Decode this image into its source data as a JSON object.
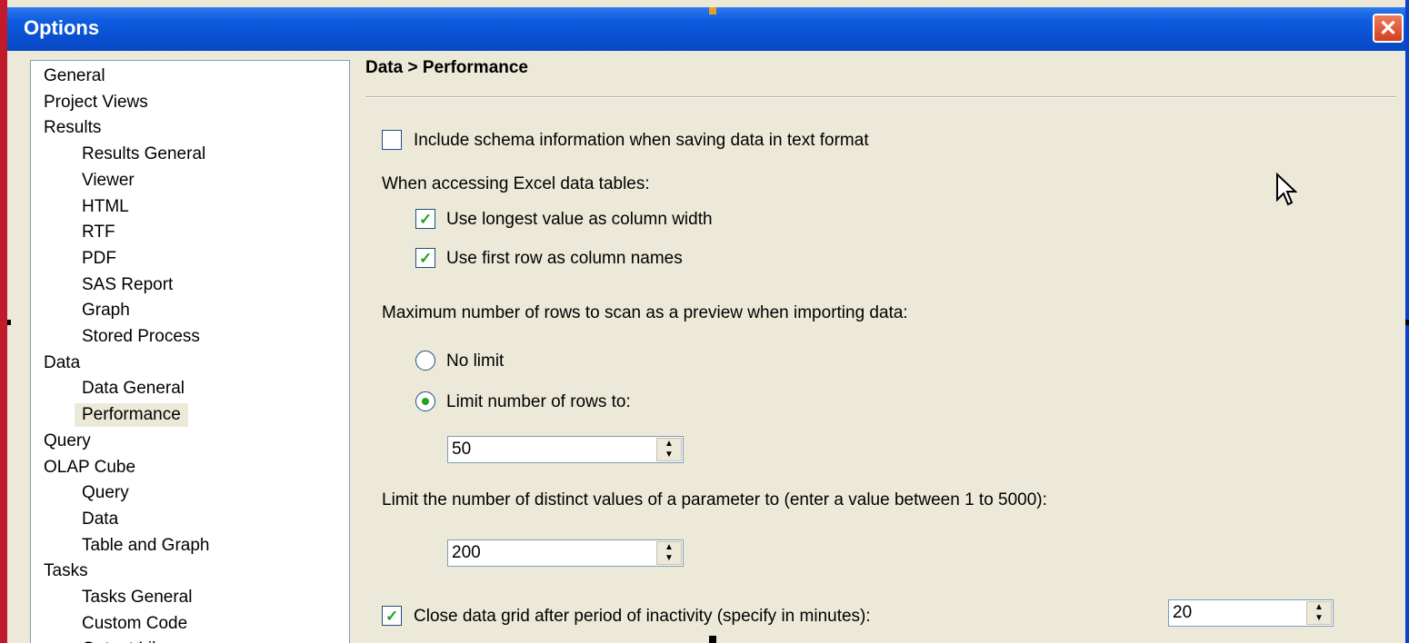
{
  "window": {
    "title": "Options",
    "close_glyph": "✕"
  },
  "tree": {
    "items": [
      {
        "label": "General",
        "indent": 0
      },
      {
        "label": "Project Views",
        "indent": 0
      },
      {
        "label": "Results",
        "indent": 0
      },
      {
        "label": "Results General",
        "indent": 1
      },
      {
        "label": "Viewer",
        "indent": 1
      },
      {
        "label": "HTML",
        "indent": 1
      },
      {
        "label": "RTF",
        "indent": 1
      },
      {
        "label": "PDF",
        "indent": 1
      },
      {
        "label": "SAS Report",
        "indent": 1
      },
      {
        "label": "Graph",
        "indent": 1
      },
      {
        "label": "Stored Process",
        "indent": 1
      },
      {
        "label": "Data",
        "indent": 0
      },
      {
        "label": "Data General",
        "indent": 1
      },
      {
        "label": "Performance",
        "indent": 1,
        "selected": true
      },
      {
        "label": "Query",
        "indent": 0
      },
      {
        "label": "OLAP Cube",
        "indent": 0
      },
      {
        "label": "Query",
        "indent": 1
      },
      {
        "label": "Data",
        "indent": 1
      },
      {
        "label": "Table and Graph",
        "indent": 1
      },
      {
        "label": "Tasks",
        "indent": 0
      },
      {
        "label": "Tasks General",
        "indent": 1
      },
      {
        "label": "Custom Code",
        "indent": 1
      },
      {
        "label": "Output Library",
        "indent": 1
      }
    ]
  },
  "panel": {
    "title": "Data > Performance",
    "include_schema": {
      "label": "Include schema information when saving data in text format",
      "checked": false
    },
    "excel_heading": "When accessing Excel data tables:",
    "longest_value": {
      "label": "Use longest value as column width",
      "checked": true
    },
    "first_row": {
      "label": "Use first row as column names",
      "checked": true
    },
    "max_rows_heading": "Maximum number of rows to scan as a preview when importing data:",
    "no_limit": {
      "label": "No limit",
      "selected": false
    },
    "limit_rows": {
      "label": "Limit number of rows to:",
      "selected": true
    },
    "rows_value": "50",
    "distinct_heading": "Limit the number of distinct values of a parameter to (enter a value between 1 to 5000):",
    "distinct_value": "200",
    "close_grid": {
      "label": "Close data grid after period of inactivity (specify in minutes):",
      "checked": true
    },
    "minutes_value": "20"
  },
  "icons": {
    "check": "✓",
    "spin_up": "▲",
    "spin_down": "▼"
  }
}
